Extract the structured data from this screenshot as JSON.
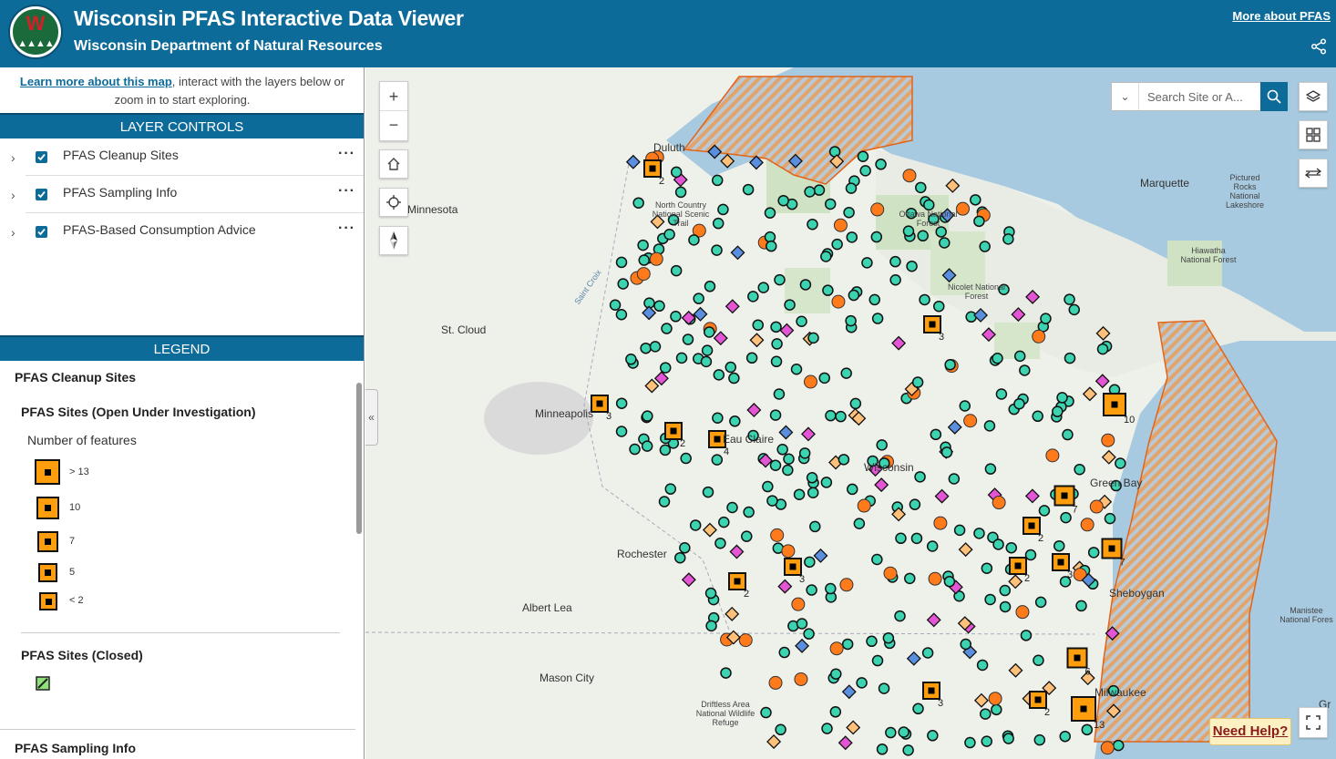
{
  "header": {
    "title": "Wisconsin PFAS Interactive Data Viewer",
    "subtitle": "Wisconsin Department of Natural Resources",
    "about_link": "More about PFAS",
    "logo_letter": "W"
  },
  "panel": {
    "intro_link": "Learn more about this map",
    "intro_text": ", interact with the layers below or zoom in to start exploring.",
    "layer_controls_title": "LAYER CONTROLS",
    "layers": [
      {
        "label": "PFAS Cleanup Sites",
        "checked": true
      },
      {
        "label": "PFAS Sampling Info",
        "checked": true
      },
      {
        "label": "PFAS-Based Consumption Advice",
        "checked": true
      }
    ],
    "legend_title": "LEGEND",
    "legend": {
      "group1": "PFAS Cleanup Sites",
      "open_title": "PFAS Sites (Open Under Investigation)",
      "count_label": "Number of features",
      "sizes": [
        "> 13",
        "10",
        "7",
        "5",
        "< 2"
      ],
      "closed_title": "PFAS Sites (Closed)",
      "group2": "PFAS Sampling Info"
    }
  },
  "map": {
    "search_placeholder": "Search Site or A...",
    "need_help": "Need Help?",
    "labels": {
      "duluth": "Duluth",
      "minnesota": "Minnesota",
      "stcloud": "St. Cloud",
      "minneapolis": "Minneapolis",
      "rochester": "Rochester",
      "albertlea": "Albert Lea",
      "masoncity": "Mason City",
      "eauclaire": "Eau Claire",
      "wisconsin": "Wisconsin",
      "greenbay": "Green Bay",
      "sheboygan": "Sheboygan",
      "milwaukee": "Milwaukee",
      "marquette": "Marquette",
      "pictured": "Pictured Rocks National Lakeshore",
      "hiawatha": "Hiawatha National Forest",
      "ottawa": "Ottawa National Forest",
      "nicolet": "Nicolet National Forest",
      "ncst": "North Country National Scenic Trail",
      "driftless": "Driftless Area National Wildlife Refuge",
      "manistee": "Manistee National Fores",
      "stcroix": "Saint Croix",
      "gr": "Gr"
    }
  },
  "colors": {
    "brand": "#0d6b9a",
    "cluster": "#ff9e0d",
    "point": "#3bd3b0",
    "orange_pt": "#ff7a1a",
    "diamond_orange": "#ffc07a",
    "diamond_pink": "#e455d6",
    "diamond_blue": "#5a8fe0"
  }
}
